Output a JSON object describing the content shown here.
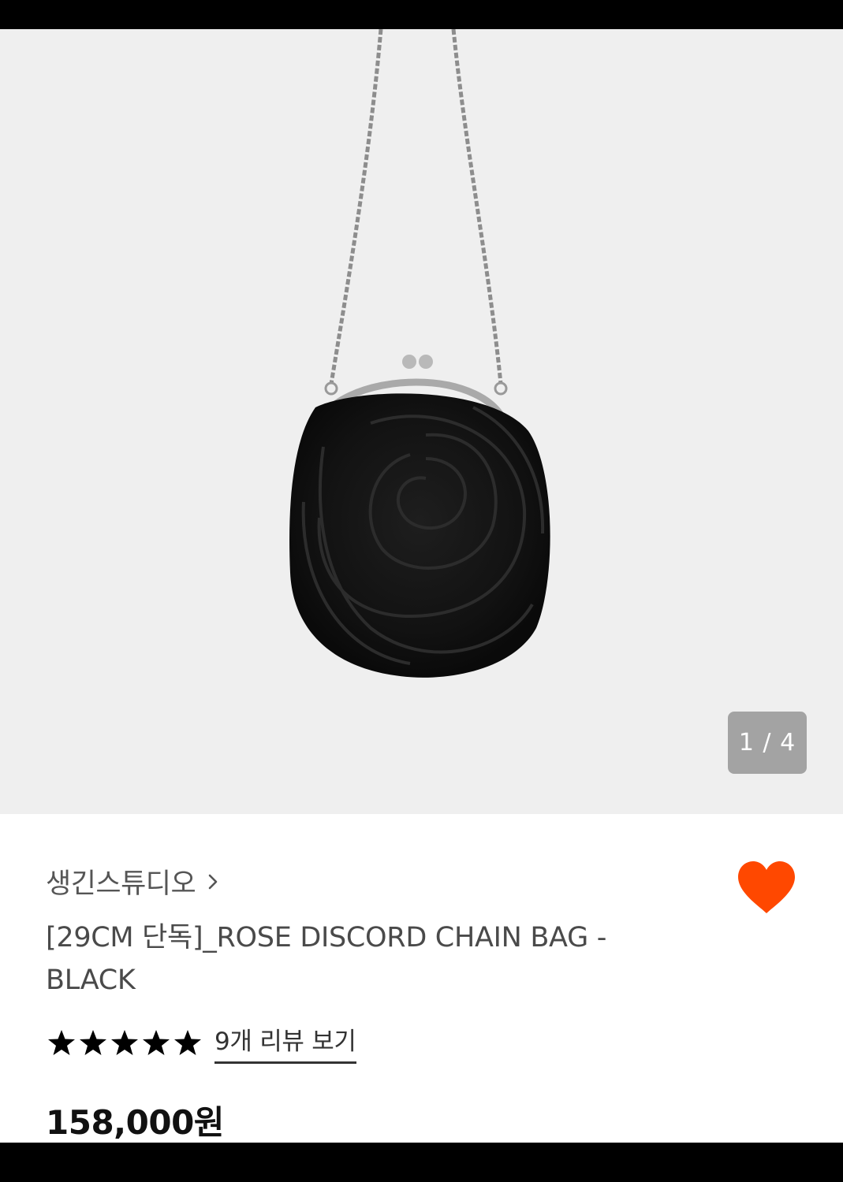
{
  "gallery": {
    "page_counter": "1 / 4",
    "current_page": 1,
    "total_pages": 4
  },
  "product": {
    "brand": "생긴스튜디오",
    "brand_chevron_icon": "chevron-right-icon",
    "title": "[29CM 단독]_ROSE DISCORD CHAIN BAG - BLACK",
    "rating_stars": 5,
    "review_link": "9개 리뷰 보기",
    "price": "158,000원",
    "wishlist_icon": "heart-icon",
    "wishlist_color": "#ff4800"
  }
}
